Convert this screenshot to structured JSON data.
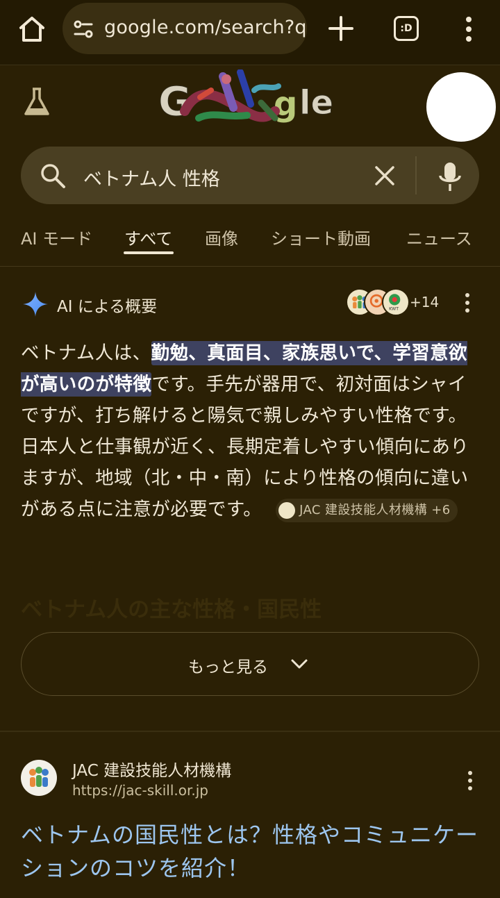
{
  "browser": {
    "url": "google.com/search?q",
    "tabs_label": ":D"
  },
  "search": {
    "query": "ベトナム人 性格"
  },
  "tabs": [
    {
      "label": "AI モード"
    },
    {
      "label": "すべて",
      "active": true
    },
    {
      "label": "画像"
    },
    {
      "label": "ショート動画"
    },
    {
      "label": "ニュース"
    }
  ],
  "ai_overview": {
    "title": "AI による概要",
    "sources_more": "+14",
    "body_lead": "ベトナム人は、",
    "body_highlight": "勤勉、真面目、家族思いで、学習意欲が高いのが特徴",
    "body_rest": "です。手先が器用で、初対面はシャイですが、打ち解けると陽気で親しみやすい性格です。日本人と仕事観が近く、長期定着しやすい傾向にありますが、地域（北・中・南）により性格の傾向に違いがある点に注意が必要です。",
    "citation": "JAC 建設技能人材機構 +6",
    "faded_heading": "ベトナム人の主な性格・国民性",
    "more_label": "もっと見る"
  },
  "result": {
    "site_name": "JAC 建設技能人材機構",
    "url": "https://jac-skill.or.jp",
    "title": "ベトナムの国民性とは？性格やコミュニケーションのコツを紹介！"
  },
  "colors": {
    "background": "#2b2005",
    "highlight": "#3e4260",
    "link": "#9dc6ef"
  }
}
